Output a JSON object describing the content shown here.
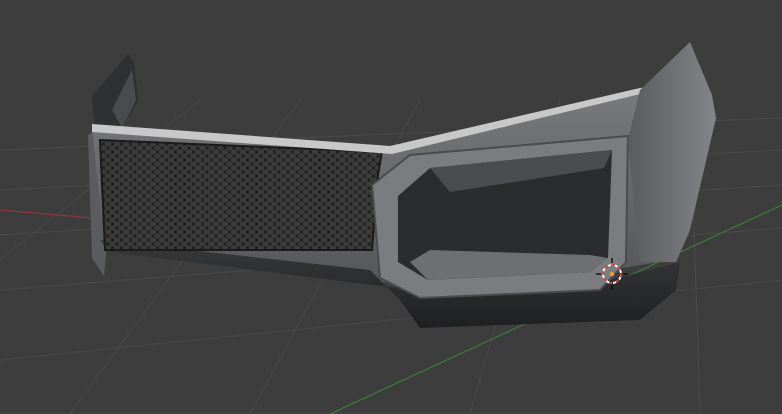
{
  "viewport": {
    "background_color": "#3d3d3d",
    "grid_line_color": "#4a4a4a",
    "x_axis_color": "#8a3a3a",
    "y_axis_color": "#3d7a3d",
    "shading_mode": "solid"
  },
  "model": {
    "object": "front-bumper",
    "parts": [
      "bumper-body",
      "mesh-grille",
      "chrome-trim",
      "fog-light-housing",
      "side-fin-left",
      "side-fin-right",
      "lower-lip"
    ],
    "body_color": "#6b6c6e",
    "grille_color": "#2a2a2a",
    "trim_color": "#c8c8c8"
  },
  "cursor_3d": {
    "icon": "3d-cursor-icon",
    "ring_colors": [
      "#d94a3a",
      "#ffffff"
    ]
  }
}
